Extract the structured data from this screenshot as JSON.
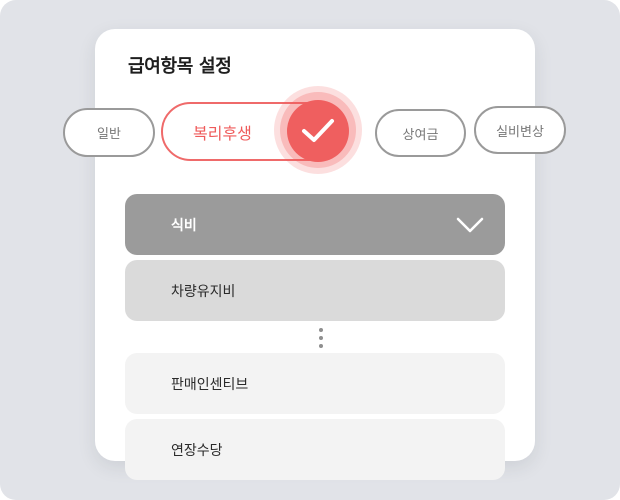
{
  "panel": {
    "title": "급여항목 설정"
  },
  "category_pills": [
    {
      "label": "일반",
      "selected": false
    },
    {
      "label": "복리후생",
      "selected": true
    },
    {
      "label": "상여금",
      "selected": false
    },
    {
      "label": "실비변상",
      "selected": false
    }
  ],
  "items": [
    {
      "label": "식비",
      "state": "expanded"
    },
    {
      "label": "차량유지비",
      "state": "hover"
    },
    {
      "label": "판매인센티브",
      "state": "default"
    },
    {
      "label": "연장수당",
      "state": "default"
    }
  ],
  "icons": {
    "selected_check": "check-icon",
    "dropdown": "chevron-down-icon",
    "more_items": "vertical-ellipsis-icon"
  },
  "colors": {
    "background": "#e1e3e8",
    "card": "#ffffff",
    "accent": "#ef5f5f",
    "selected_row": "#9b9b9b",
    "hover_row": "#dadada",
    "default_row": "#f3f3f3"
  }
}
